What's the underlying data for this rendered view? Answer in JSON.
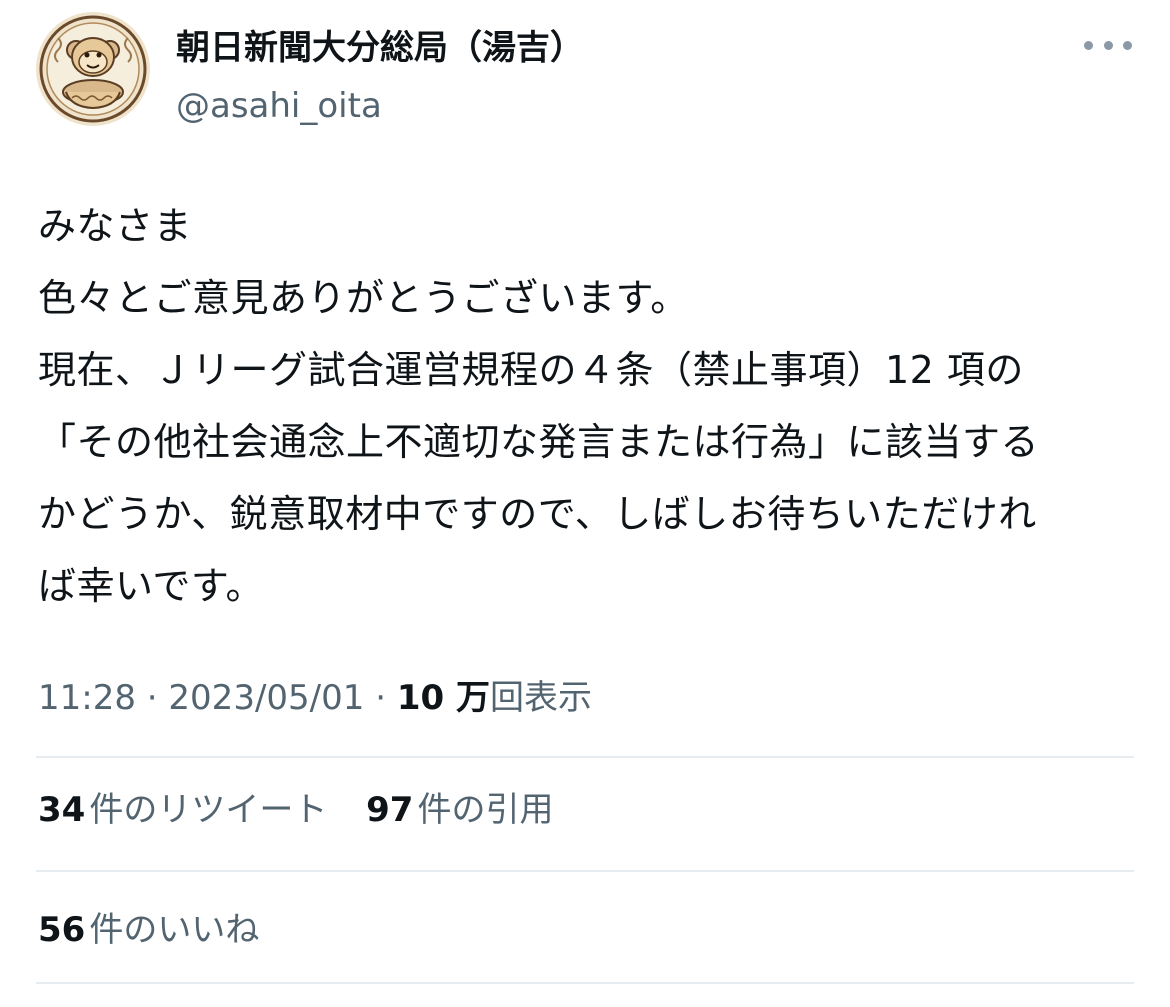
{
  "author": {
    "name": "朝日新聞大分総局（湯吉）",
    "handle": "@asahi_oita",
    "avatar_icon": "monkey-avatar-icon"
  },
  "more_icon": "more-horizontal-icon",
  "tweet": {
    "lines": [
      "みなさま",
      "色々とご意見ありがとうございます。",
      "現在、Ｊリーグ試合運営規程の４条（禁止事項）12 項の",
      "「その他社会通念上不適切な発言または行為」に該当する",
      "かどうか、鋭意取材中ですので、しばしお待ちいただけれ",
      "ば幸いです。"
    ]
  },
  "meta": {
    "time": "11:28",
    "separator": " · ",
    "date": "2023/05/01",
    "views_count": "10 万",
    "views_label": "回表示"
  },
  "stats": {
    "retweets_count": "34",
    "retweets_label": "件のリツイート",
    "quotes_count": "97",
    "quotes_label": "件の引用",
    "likes_count": "56",
    "likes_label": "件のいいね"
  },
  "colors": {
    "text": "#0f1419",
    "secondary": "#536471",
    "divider": "#e6ecf0"
  }
}
